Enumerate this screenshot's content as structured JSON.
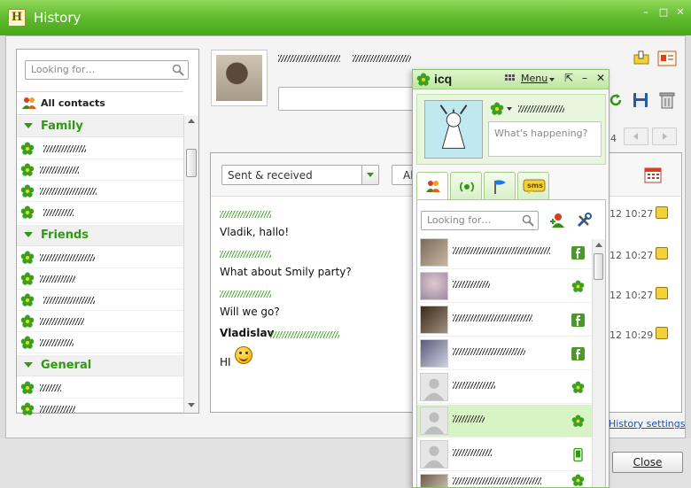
{
  "window": {
    "title": "History",
    "logo_letter": "H",
    "min_glyph": "–",
    "max_glyph": "□",
    "close_glyph": "✕"
  },
  "left_panel": {
    "search_placeholder": "Looking for…",
    "all_contacts_label": "All contacts",
    "groups": [
      {
        "name": "Family"
      },
      {
        "name": "Friends"
      },
      {
        "name": "General"
      }
    ]
  },
  "conversation": {
    "filter_selected": "Sent & received",
    "second_filter_partial": "Al",
    "page_partial": "4",
    "messages": [
      {
        "text": "Vladik, hallo!",
        "time": "12 10:27"
      },
      {
        "text": "What about Smily party?",
        "time": "12 10:27"
      },
      {
        "text": "Will we go?",
        "time": "12 10:27"
      },
      {
        "sender": "Vladislav",
        "text": "HI",
        "time": "12 10:29"
      }
    ],
    "history_settings_label": "History settings"
  },
  "footer": {
    "close_label": "Close"
  },
  "icq": {
    "brand": "icq",
    "menu_label": "Menu",
    "status_placeholder": "What's happening?",
    "search_placeholder": "Looking for…",
    "tab_sms_label": "sms",
    "contacts": [
      {
        "net": "facebook",
        "selected": false
      },
      {
        "net": "icq",
        "selected": false
      },
      {
        "net": "facebook",
        "selected": false
      },
      {
        "net": "facebook",
        "selected": false
      },
      {
        "net": "icq",
        "selected": false
      },
      {
        "net": "icq",
        "selected": true
      },
      {
        "net": "mobile",
        "selected": false
      },
      {
        "net": "icq",
        "selected": false
      }
    ]
  },
  "colors": {
    "accent_green": "#2e9a12",
    "title_green": "#5cb82a",
    "link_blue": "#1f4fa8"
  }
}
